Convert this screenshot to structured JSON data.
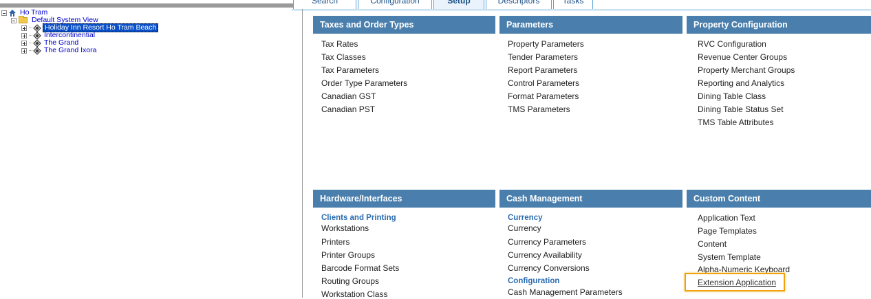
{
  "tree": {
    "root": "Ho Tram",
    "system_view": "Default System View",
    "properties": [
      "Holiday Inn Resort Ho Tram Beach",
      "Intercontinential",
      "The Grand",
      "The Grand Ixora"
    ]
  },
  "tabs": [
    "Search",
    "Configuration",
    "Setup",
    "Descriptors",
    "Tasks"
  ],
  "active_tab": "Setup",
  "panels": {
    "taxes": {
      "title": "Taxes and Order Types",
      "items": [
        "Tax Rates",
        "Tax Classes",
        "Tax Parameters",
        "Order Type Parameters",
        "Canadian GST",
        "Canadian PST"
      ]
    },
    "parameters": {
      "title": "Parameters",
      "items": [
        "Property Parameters",
        "Tender Parameters",
        "Report Parameters",
        "Control Parameters",
        "Format Parameters",
        "TMS Parameters"
      ]
    },
    "property_config": {
      "title": "Property Configuration",
      "items": [
        "RVC Configuration",
        "Revenue Center Groups",
        "Property Merchant Groups",
        "Reporting and Analytics",
        "Dining Table Class",
        "Dining Table Status Set",
        "TMS Table Attributes"
      ]
    },
    "hardware": {
      "title": "Hardware/Interfaces",
      "subheading": "Clients and Printing",
      "items": [
        "Workstations",
        "Printers",
        "Printer Groups",
        "Barcode Format Sets",
        "Routing Groups",
        "Workstation Class"
      ]
    },
    "cash": {
      "title": "Cash Management",
      "subheading_1": "Currency",
      "items_1": [
        "Currency",
        "Currency Parameters",
        "Currency Availability",
        "Currency Conversions"
      ],
      "subheading_2": "Configuration",
      "items_2": [
        "Cash Management Parameters"
      ]
    },
    "custom": {
      "title": "Custom Content",
      "items": [
        "Application Text",
        "Page Templates",
        "Content",
        "System Template",
        "Alpha-Numeric Keyboard",
        "Extension Application"
      ]
    }
  },
  "colors": {
    "header_bg": "#4a7fad",
    "subheading": "#2b6cb0",
    "highlight": "#f0a30a",
    "selection": "#0a50c8"
  }
}
